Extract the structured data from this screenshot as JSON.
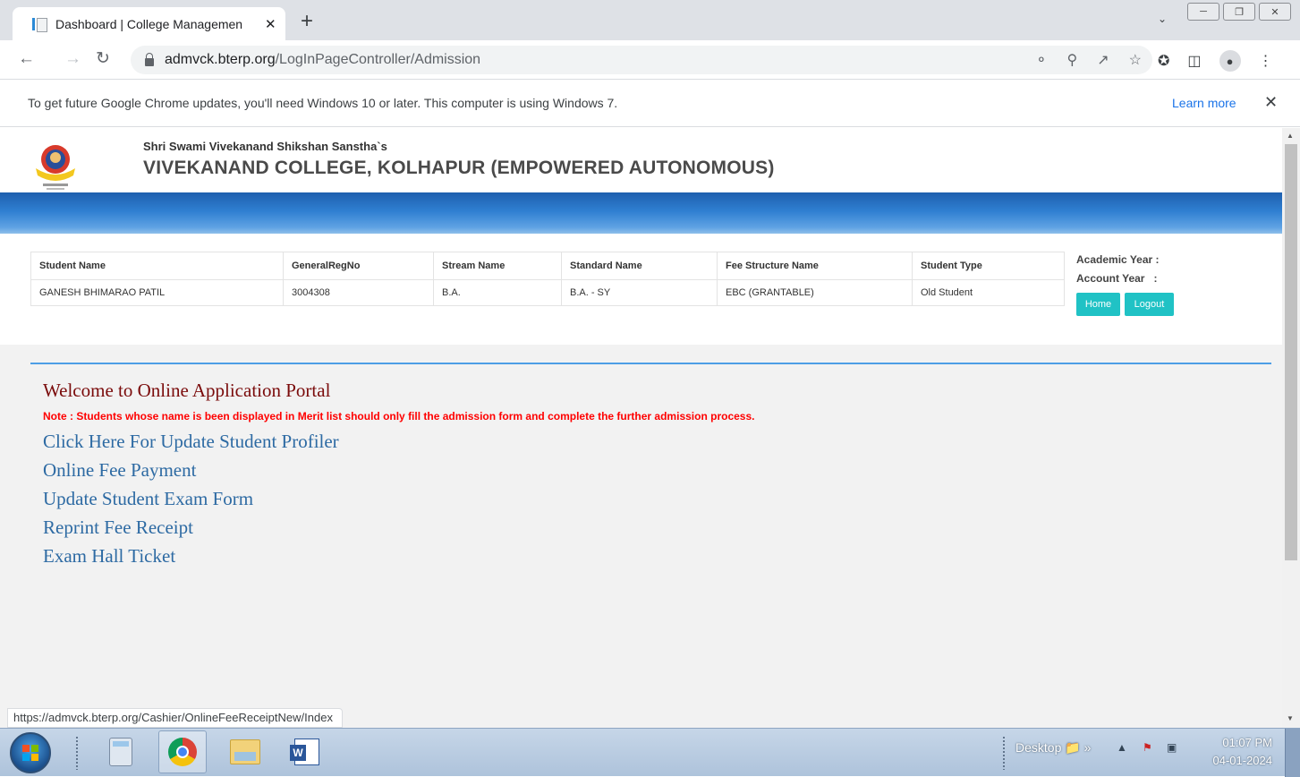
{
  "browser": {
    "tab_title": "Dashboard | College Managemen",
    "tab_close": "✕",
    "new_tab": "+",
    "url_domain": "admvck.bterp.org",
    "url_path": "/LogInPageController/Admission",
    "info_message": "To get future Google Chrome updates, you'll need Windows 10 or later. This computer is using Windows 7.",
    "learn_more": "Learn more",
    "info_close": "✕",
    "status_url": "https://admvck.bterp.org/Cashier/OnlineFeeReceiptNew/Index"
  },
  "header": {
    "society": "Shri Swami Vivekanand Shikshan Sanstha`s",
    "college": "VIVEKANAND COLLEGE, KOLHAPUR (EMPOWERED AUTONOMOUS)"
  },
  "student_table": {
    "headers": [
      "Student Name",
      "GeneralRegNo",
      "Stream Name",
      "Standard Name",
      "Fee Structure Name",
      "Student Type"
    ],
    "row": [
      "GANESH BHIMARAO PATIL",
      "3004308",
      "B.A.",
      "B.A. - SY",
      "EBC (GRANTABLE)",
      "Old Student"
    ]
  },
  "years": {
    "academic": "Academic Year :",
    "account": "Account Year   :"
  },
  "buttons": {
    "home": "Home",
    "logout": "Logout"
  },
  "content": {
    "welcome": "Welcome to Online Application Portal",
    "note": "Note : Students whose name is been displayed in Merit list should only fill the admission form and complete the further admission process.",
    "links": [
      "Click Here For Update Student Profiler",
      "Online Fee Payment",
      "Update Student Exam Form",
      "Reprint Fee Receipt",
      "Exam Hall Ticket"
    ]
  },
  "taskbar": {
    "desktop_label": "Desktop",
    "time": "01:07 PM",
    "date": "04-01-2024"
  },
  "colors": {
    "banner": "#2f7fd1",
    "button": "#20c2c5",
    "welcome": "#7a0b0b",
    "note": "#ff0000",
    "link": "#2d6aa3",
    "divider": "#4d9ee6"
  }
}
